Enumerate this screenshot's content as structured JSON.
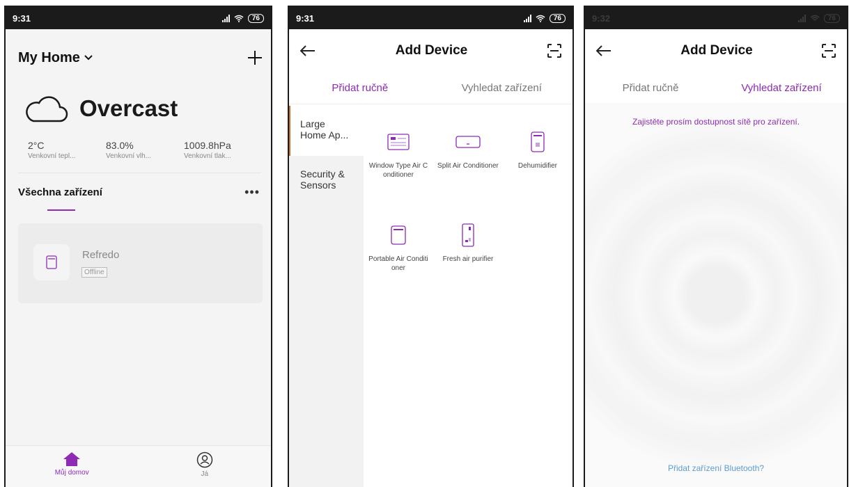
{
  "colors": {
    "accent": "#8e2ab6",
    "link": "#5d9bd0"
  },
  "panel1": {
    "status_time": "9:31",
    "battery": "76",
    "home_title": "My Home",
    "weather": {
      "icon": "cloud-icon",
      "condition": "Overcast"
    },
    "stats": [
      {
        "value": "2°C",
        "label": "Venkovní tepl..."
      },
      {
        "value": "83.0%",
        "label": "Venkovní vlh..."
      },
      {
        "value": "1009.8hPa",
        "label": "Venkovní tlak..."
      }
    ],
    "devices_title": "Všechna zařízení",
    "device": {
      "name": "Refredo",
      "status": "Offline"
    },
    "nav": [
      {
        "label": "Můj domov",
        "icon": "home-icon",
        "active": true
      },
      {
        "label": "Já",
        "icon": "profile-icon",
        "active": false
      }
    ]
  },
  "panel2": {
    "status_time": "9:31",
    "battery": "76",
    "title": "Add Device",
    "tabs": [
      "Přidat ručně",
      "Vyhledat zařízení"
    ],
    "categories": [
      "Large Home Ap...",
      "Security & Sensors"
    ],
    "devices": [
      {
        "label": "Window Type Air Conditioner",
        "icon": "window-ac-icon"
      },
      {
        "label": "Split Air Conditioner",
        "icon": "split-ac-icon"
      },
      {
        "label": "Dehumidifier",
        "icon": "dehumidifier-icon"
      },
      {
        "label": "Portable Air Conditioner",
        "icon": "portable-ac-icon"
      },
      {
        "label": "Fresh air purifier",
        "icon": "air-purifier-icon"
      }
    ]
  },
  "panel3": {
    "status_time": "9:32",
    "battery": "76",
    "title": "Add Device",
    "tabs": [
      "Přidat ručně",
      "Vyhledat zařízení"
    ],
    "message": "Zajistěte prosím dostupnost sítě pro zařízení.",
    "bluetooth_link": "Přidat zařízení Bluetooth?"
  }
}
